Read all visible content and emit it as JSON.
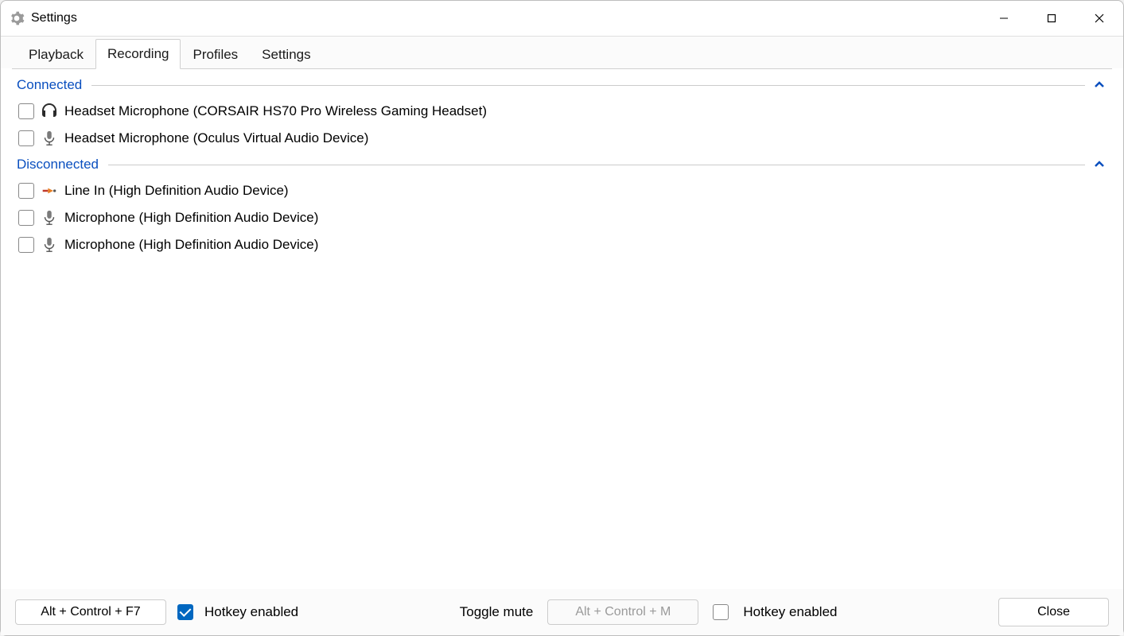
{
  "window": {
    "title": "Settings"
  },
  "tabs": [
    {
      "label": "Playback",
      "active": false
    },
    {
      "label": "Recording",
      "active": true
    },
    {
      "label": "Profiles",
      "active": false
    },
    {
      "label": "Settings",
      "active": false
    }
  ],
  "groups": {
    "connected": {
      "label": "Connected",
      "devices": [
        {
          "icon": "headset",
          "label": "Headset Microphone (CORSAIR HS70 Pro Wireless Gaming Headset)"
        },
        {
          "icon": "mic",
          "label": "Headset Microphone (Oculus Virtual Audio Device)"
        }
      ]
    },
    "disconnected": {
      "label": "Disconnected",
      "devices": [
        {
          "icon": "linein",
          "label": "Line In (High Definition Audio Device)"
        },
        {
          "icon": "mic",
          "label": "Microphone (High Definition Audio Device)"
        },
        {
          "icon": "mic",
          "label": "Microphone (High Definition Audio Device)"
        }
      ]
    }
  },
  "footer": {
    "hotkey1": "Alt + Control + F7",
    "hotkey1_enabled_label": "Hotkey enabled",
    "hotkey1_checked": true,
    "toggle_mute_label": "Toggle mute",
    "hotkey2": "Alt + Control + M",
    "hotkey2_enabled_label": "Hotkey enabled",
    "hotkey2_checked": false,
    "close": "Close"
  }
}
